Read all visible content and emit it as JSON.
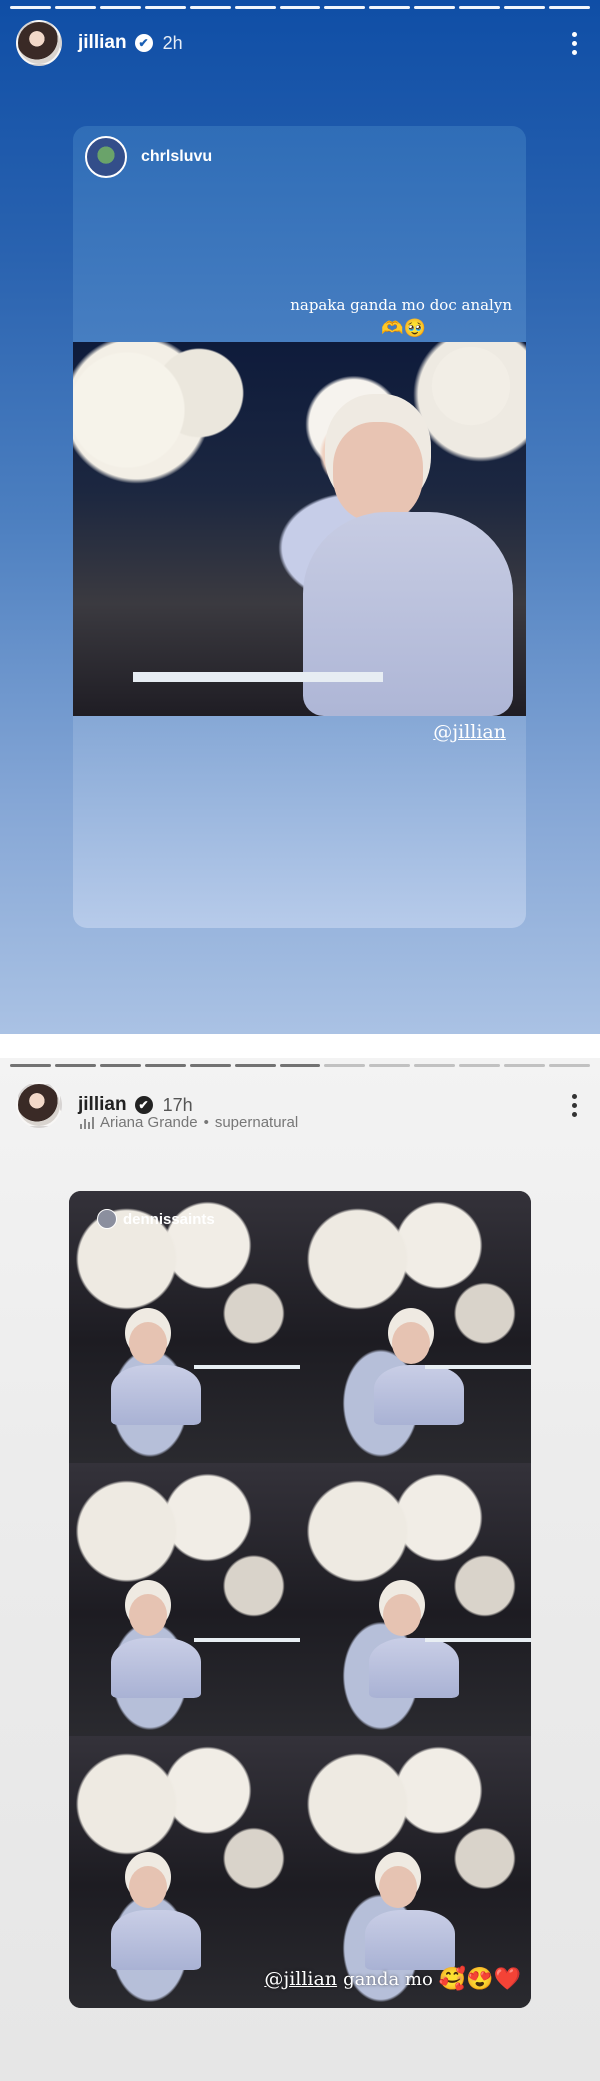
{
  "story1": {
    "username": "jillian",
    "time": "2h",
    "verified_mark": "✔",
    "more_icon": "more-vertical-icon",
    "reshared_post": {
      "username": "chrlsluvu",
      "caption": "napaka ganda mo doc analyn",
      "caption_emoji": "🫶🥹",
      "mention": "@jillian"
    }
  },
  "story2": {
    "username": "jillian",
    "time": "17h",
    "verified_mark": "✔",
    "music": {
      "artist": "Ariana Grande",
      "separator": "•",
      "song": "supernatural"
    },
    "reshared_post": {
      "username": "dennissaints",
      "mention": "@jillian",
      "caption": "ganda mo",
      "emojis": "🥰😍❤️"
    }
  },
  "colors": {
    "story1_top": "#0f4ea6",
    "story1_bottom": "#aac2e4",
    "story2_bg": "#ececec"
  }
}
